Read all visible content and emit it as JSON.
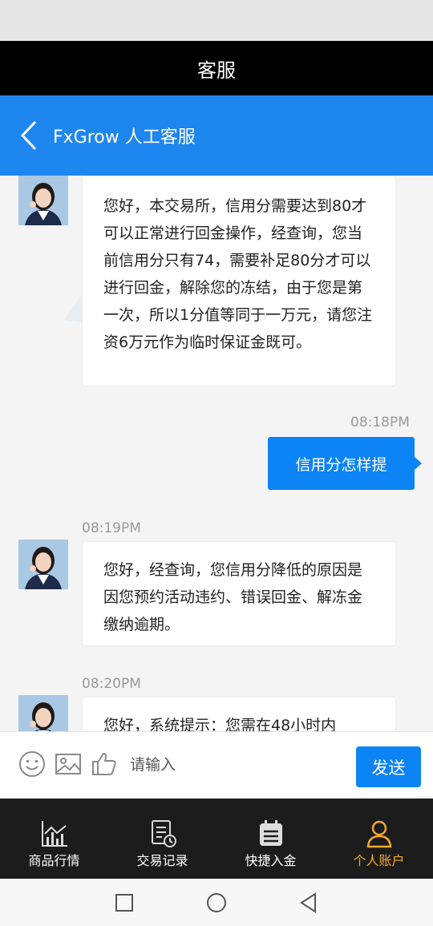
{
  "window": {
    "title": "客服"
  },
  "chat_header": {
    "title": "FxGrow 人工客服"
  },
  "messages": [
    {
      "from": "agent",
      "text": "您好，本交易所，信用分需要达到80才可以正常进行回金操作，经查询，您当前信用分只有74，需要补足80分才可以进行回金，解除您的冻结，由于您是第一次，所以1分值等同于一万元，请您注资6万元作为临时保证金既可。"
    },
    {
      "from": "user",
      "time": "08:18PM",
      "text": "信用分怎样提"
    },
    {
      "from": "agent",
      "time": "08:19PM",
      "text": "您好，经查询，您信用分降低的原因是因您预约活动违约、错误回金、解冻金缴纳逾期。"
    },
    {
      "from": "agent",
      "time": "08:20PM",
      "text": "您好，系统提示：您需在48小时内"
    }
  ],
  "input_bar": {
    "placeholder": "请输入",
    "send_label": "发送",
    "icons": [
      "emoji-icon",
      "image-icon",
      "thumbs-up-icon"
    ]
  },
  "bottom_nav": {
    "items": [
      {
        "label": "商品行情",
        "icon": "chart-icon",
        "active": false
      },
      {
        "label": "交易记录",
        "icon": "record-icon",
        "active": false
      },
      {
        "label": "快捷入金",
        "icon": "calendar-icon",
        "active": false
      },
      {
        "label": "个人账户",
        "icon": "user-icon",
        "active": true
      }
    ]
  },
  "colors": {
    "header_blue": "#1e86ef",
    "send_blue": "#0d84f5",
    "active_nav": "#f0a92a",
    "nav_bg": "#1c1c1c"
  }
}
